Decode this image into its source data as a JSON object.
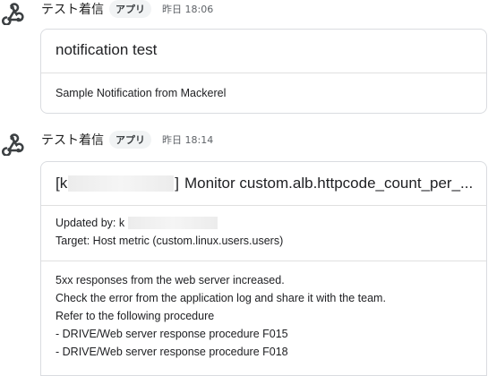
{
  "messages": [
    {
      "sender": "テスト着信",
      "badge": "アプリ",
      "timestamp": "昨日 18:06",
      "avatar_icon": "webhook-icon",
      "card": {
        "title": "notification test",
        "body": "Sample Notification from Mackerel"
      }
    },
    {
      "sender": "テスト着信",
      "badge": "アプリ",
      "timestamp": "昨日 18:14",
      "avatar_icon": "webhook-icon",
      "card": {
        "title_prefix": "[k",
        "title_suffix": "]",
        "title_text": "Monitor custom.alb.httpcode_count_per_...",
        "updated_by_label": "Updated by: k",
        "target": "Target: Host metric (custom.linux.users.users)",
        "description_lines": [
          "5xx responses from the web server increased.",
          "Check the error from the application log and share it with the team.",
          "Refer to the following procedure",
          "- DRIVE/Web server response procedure F015",
          "- DRIVE/Web server response procedure F018"
        ]
      }
    }
  ]
}
